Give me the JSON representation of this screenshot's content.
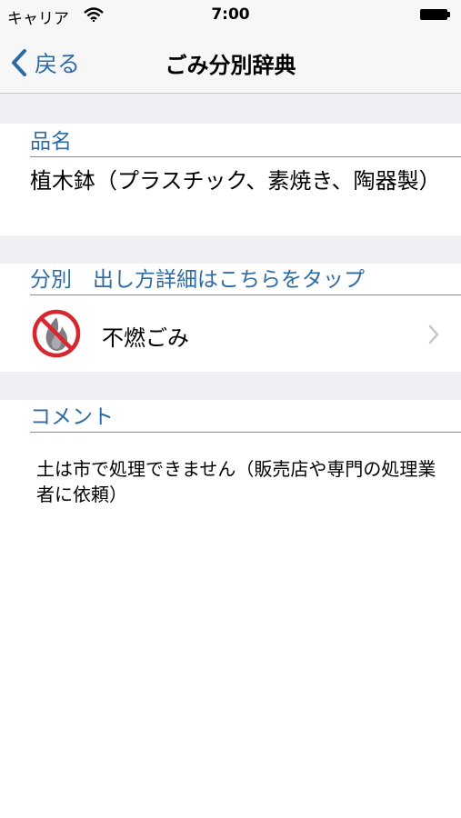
{
  "status_bar": {
    "carrier": "キャリア",
    "time": "7:00",
    "icons": [
      "wifi-icon",
      "battery-icon"
    ]
  },
  "nav": {
    "back_label": "戻る",
    "title": "ごみ分別辞典",
    "accent_color": "#2f6ba3"
  },
  "item": {
    "header": "品名",
    "name": "植木鉢（プラスチック、素焼き、陶器製）"
  },
  "category": {
    "header": "分別　出し方詳細はこちらをタップ",
    "label": "不燃ごみ",
    "icon": "non-burnable-icon"
  },
  "comment": {
    "header": "コメント",
    "text": "土は市で処理できません（販売店や専門の処理業者に依頼）"
  }
}
